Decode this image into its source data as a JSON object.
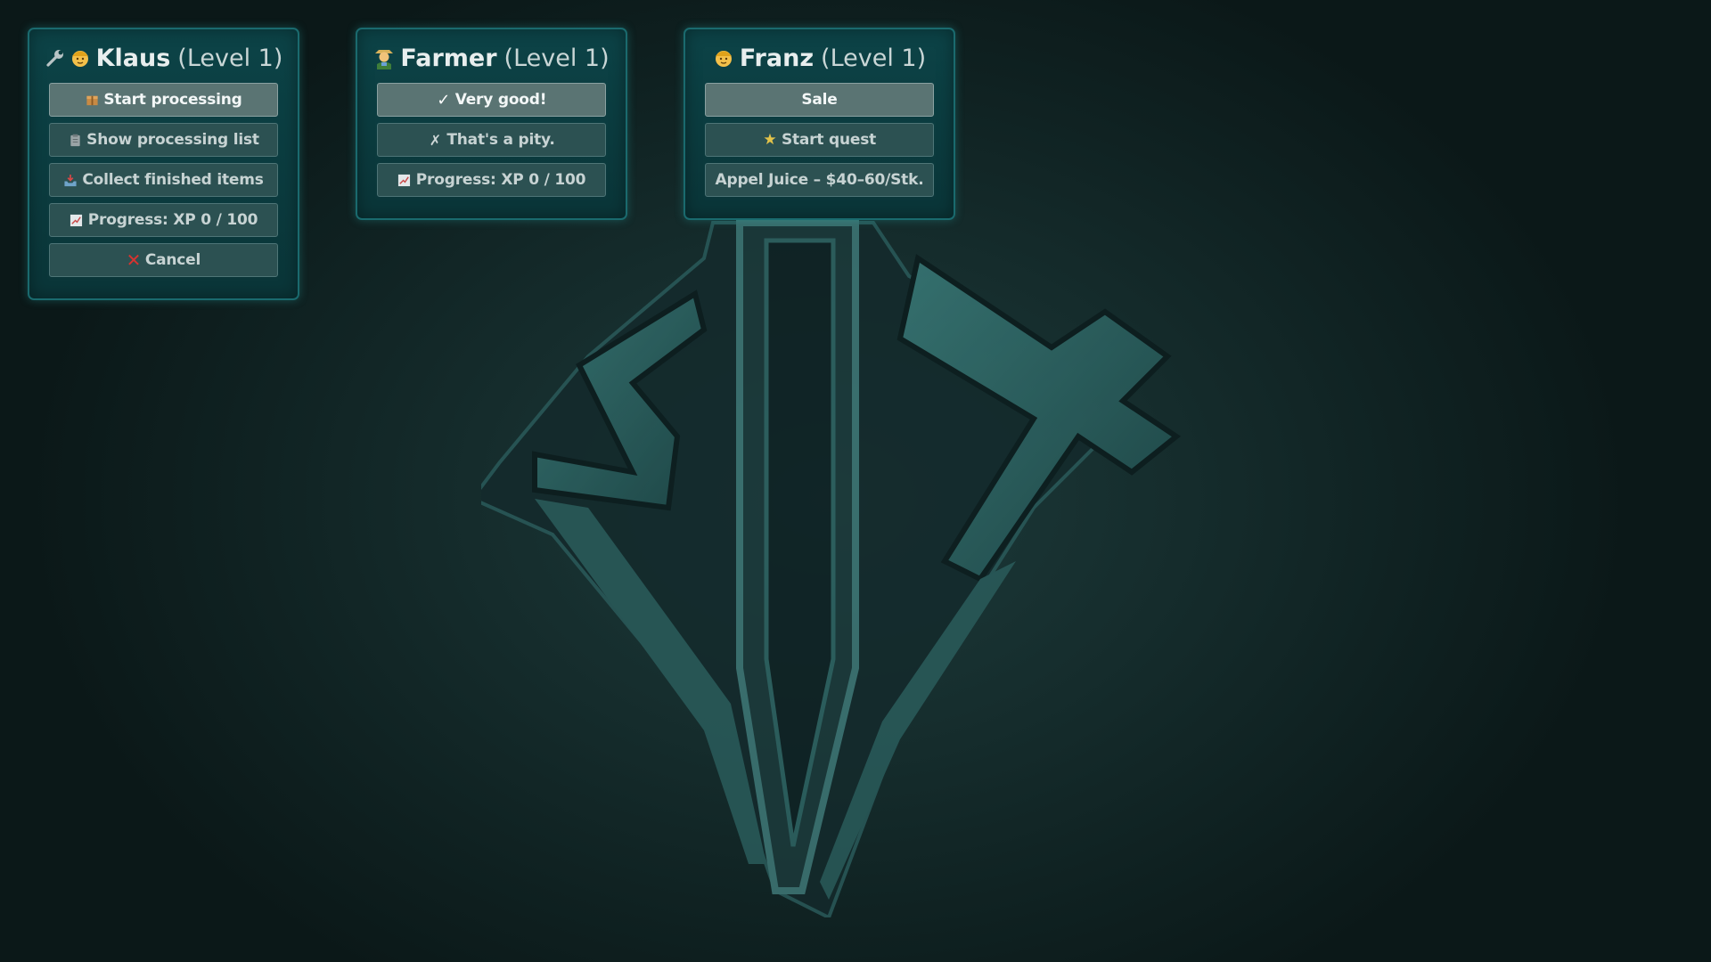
{
  "background": {
    "logo_icon": "diamond-emblem-logo"
  },
  "panels": [
    {
      "icons": [
        "wrench-icon",
        "worker-face-icon"
      ],
      "name": "Klaus",
      "level": "(Level 1)",
      "buttons": [
        {
          "icon": "package-icon",
          "label": "Start processing",
          "active": true
        },
        {
          "icon": "clipboard-icon",
          "label": "Show processing list",
          "active": false
        },
        {
          "icon": "inbox-tray-icon",
          "label": "Collect finished items",
          "active": false
        },
        {
          "icon": "chart-icon",
          "label": "Progress: XP 0 / 100",
          "active": false
        },
        {
          "icon": "cross-mark-icon",
          "label": "Cancel",
          "active": false
        }
      ]
    },
    {
      "icons": [
        "farmer-icon"
      ],
      "name": "Farmer",
      "level": "(Level 1)",
      "buttons": [
        {
          "icon": "check-icon",
          "label": "Very good!",
          "active": true
        },
        {
          "icon": "x-icon",
          "label": "That's a pity.",
          "active": false
        },
        {
          "icon": "chart-icon",
          "label": "Progress: XP 0 / 100",
          "active": false
        }
      ]
    },
    {
      "icons": [
        "worker-face-icon"
      ],
      "name": "Franz",
      "level": "(Level 1)",
      "buttons": [
        {
          "icon": "",
          "label": "Sale",
          "active": true
        },
        {
          "icon": "star-icon",
          "label": "Start quest",
          "active": false
        },
        {
          "icon": "",
          "label": "Appel Juice – $40–60/Stk.",
          "active": false
        }
      ]
    }
  ],
  "colors": {
    "panel_bg": "#0c4347",
    "panel_border": "#1a6a6e",
    "button_bg": "#2c5152",
    "button_active_bg": "#5a7473",
    "cancel_red": "#d8332f",
    "star_gold": "#e3c34a"
  }
}
